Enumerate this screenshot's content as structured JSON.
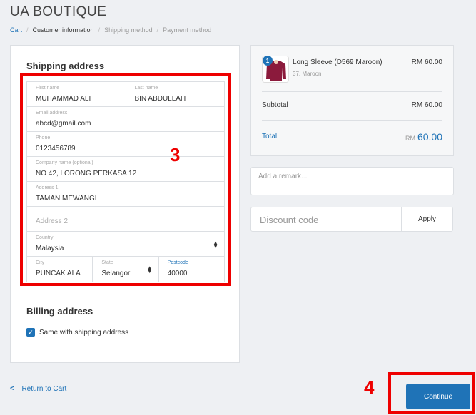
{
  "store": {
    "title": "UA BOUTIQUE"
  },
  "breadcrumb": {
    "cart": "Cart",
    "customer_info": "Customer information",
    "shipping_method": "Shipping method",
    "payment_method": "Payment method",
    "separator": "/"
  },
  "shipping": {
    "title": "Shipping address",
    "first_name": {
      "label": "First name",
      "value": "MUHAMMAD ALI"
    },
    "last_name": {
      "label": "Last name",
      "value": "BIN ABDULLAH"
    },
    "email": {
      "label": "Email address",
      "value": "abcd@gmail.com"
    },
    "phone": {
      "label": "Phone",
      "value": "0123456789"
    },
    "company": {
      "label": "Company name (optional)",
      "value": "NO 42, LORONG PERKASA 12"
    },
    "address1": {
      "label": "Address 1",
      "value": "TAMAN MEWANGI"
    },
    "address2": {
      "placeholder": "Address 2"
    },
    "country": {
      "label": "Country",
      "value": "Malaysia"
    },
    "city": {
      "label": "City",
      "value": "PUNCAK ALA"
    },
    "state": {
      "label": "State",
      "value": "Selangor"
    },
    "postcode": {
      "label": "Postcode",
      "value": "40000"
    }
  },
  "billing": {
    "title": "Billing address",
    "same_label": "Same with shipping address",
    "checked": true
  },
  "summary": {
    "product_name": "Long Sleeve (D569 Maroon)",
    "product_variant": "37, Maroon",
    "product_price": "RM 60.00",
    "quantity": "1",
    "subtotal_label": "Subtotal",
    "subtotal_value": "RM 60.00",
    "total_label": "Total",
    "total_currency": "RM",
    "total_amount": "60.00"
  },
  "remark": {
    "placeholder": "Add a remark..."
  },
  "discount": {
    "placeholder": "Discount code",
    "apply_label": "Apply"
  },
  "footer": {
    "return_label": "Return to Cart",
    "continue_label": "Continue"
  },
  "annotations": {
    "step3": "3",
    "step4": "4"
  },
  "colors": {
    "accent": "#1f73b7",
    "annotation": "#e00000",
    "product": "#8b1a3c"
  },
  "icons": {
    "select": "select-arrows-icon",
    "back": "chevron-left-icon",
    "check": "checkmark-icon"
  }
}
